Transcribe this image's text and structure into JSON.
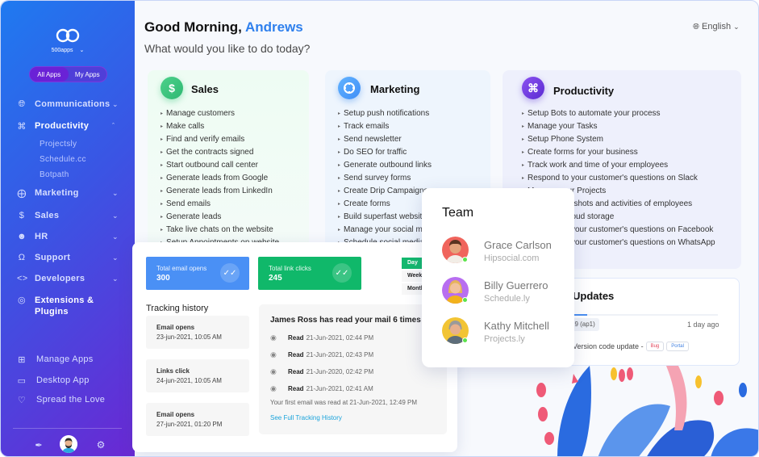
{
  "sidebar": {
    "brand": "500apps",
    "toggle": {
      "all_apps": "All Apps",
      "my_apps": "My Apps"
    },
    "nav": [
      {
        "icon": "globe-icon",
        "label": "Communications",
        "expanded": false
      },
      {
        "icon": "command-icon",
        "label": "Productivity",
        "expanded": true,
        "children": [
          "Projectsly",
          "Schedule.cc",
          "Botpath"
        ]
      },
      {
        "icon": "target-icon",
        "label": "Marketing",
        "expanded": false
      },
      {
        "icon": "dollar-icon",
        "label": "Sales",
        "expanded": false
      },
      {
        "icon": "user-icon",
        "label": "HR",
        "expanded": false
      },
      {
        "icon": "headphones-icon",
        "label": "Support",
        "expanded": false
      },
      {
        "icon": "code-icon",
        "label": "Developers",
        "expanded": false
      },
      {
        "icon": "chrome-icon",
        "label": "Extensions & Plugins"
      }
    ],
    "bottom_nav": [
      {
        "icon": "grid-icon",
        "label": "Manage Apps"
      },
      {
        "icon": "monitor-icon",
        "label": "Desktop App"
      },
      {
        "icon": "heart-icon",
        "label": "Spread the Love"
      }
    ]
  },
  "header": {
    "greeting": "Good Morning,",
    "user_name": "Andrews",
    "subtitle": "What would you like to do today?",
    "language": "English"
  },
  "categories": [
    {
      "title": "Sales",
      "icon": "dollar-icon",
      "items": [
        "Manage customers",
        "Make calls",
        "Find and verify emails",
        "Get the contracts signed",
        "Start outbound call center",
        "Generate leads from Google",
        "Generate leads from LinkedIn",
        "Send emails",
        "Generate leads",
        "Take live chats on the website",
        "Setup Appointments on website"
      ]
    },
    {
      "title": "Marketing",
      "icon": "target-icon",
      "items": [
        "Setup push notifications",
        "Track emails",
        "Send newsletter",
        "Do SEO for traffic",
        "Generate outbound links",
        "Send survey forms",
        "Create Drip Campaigns",
        "Create forms",
        "Build superfast websites",
        "Manage your social media",
        "Schedule social media"
      ]
    },
    {
      "title": "Productivity",
      "icon": "command-icon",
      "items": [
        "Setup Bots to automate your process",
        "Manage your Tasks",
        "Setup Phone System",
        "Create forms for your business",
        "Track work and time of your employees",
        "Respond to your customer's questions on Slack",
        "Manage your Projects",
        "Track screenshots and activities of employees",
        "Backup to cloud storage",
        "Respond to your customer's questions on Facebook",
        "Respond to your customer's questions on WhatsApp"
      ]
    }
  ],
  "tracking": {
    "stats": [
      {
        "label": "Total email opens",
        "value": "300",
        "color": "#4a90f5"
      },
      {
        "label": "Total link clicks",
        "value": "245",
        "color": "#10b86a"
      }
    ],
    "periods": [
      "Day",
      "Week",
      "Month"
    ],
    "active_period": "Day",
    "history_title": "Tracking history",
    "history": [
      {
        "type": "Email opens",
        "time": "23-jun-2021, 10:05 AM"
      },
      {
        "type": "Links click",
        "time": "24-jun-2021, 10:05 AM"
      },
      {
        "type": "Email opens",
        "time": "27-jun-2021, 01:20 PM"
      }
    ],
    "reads_title": "James Ross has read your mail 6 times",
    "read_label": "Read",
    "reads": [
      "21-Jun-2021, 02:44 PM",
      "21-Jun-2021, 02:43 PM",
      "21-Jun-2020, 02:42 PM",
      "21-Jun-2021, 02:41 AM"
    ],
    "first_read": "Your first email was read at 21-Jun-2021, 12:49 PM",
    "full_history_link": "See Full Tracking History"
  },
  "team": {
    "title": "Team",
    "members": [
      {
        "name": "Grace Carlson",
        "company": "Hipsocial.com",
        "status": "online",
        "avatar_color": "#f0645c"
      },
      {
        "name": "Billy Guerrero",
        "company": "Schedule.ly",
        "status": "online",
        "avatar_color": "#b86ef0"
      },
      {
        "name": "Kathy Mitchell",
        "company": "Projects.ly",
        "status": "online",
        "avatar_color": "#f2c434"
      }
    ]
  },
  "updates": {
    "title": "Updates",
    "tag": "29 (ap1)",
    "time": "1 day ago",
    "description": "Version code update -",
    "labels": [
      "Bug",
      "Portal"
    ]
  }
}
